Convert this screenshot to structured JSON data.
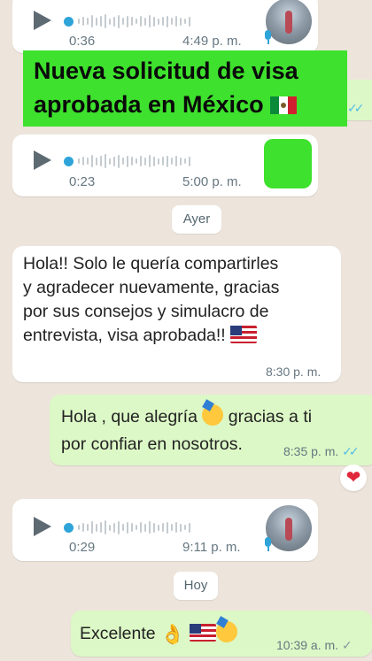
{
  "messages": {
    "voice1": {
      "duration": "0:36",
      "time": "4:49 p. m."
    },
    "voice2": {
      "duration": "0:23",
      "time": "5:00 p. m."
    },
    "day_yesterday": "Ayer",
    "msg_in_1": {
      "text": "Hola!! Solo le quería compartirles\ny agradecer nuevamente, gracias\npor sus consejos y simulacro de\nentrevista, visa aprobada!! ",
      "time": "8:30 p. m."
    },
    "msg_out_1": {
      "text_a": "Hola , que alegría ",
      "text_b": " gracias a ti",
      "text_c": "por confiar en nosotros.",
      "time": "8:35 p. m.",
      "reaction": "❤"
    },
    "voice3": {
      "duration": "0:29",
      "time": "9:11 p. m."
    },
    "day_today": "Hoy",
    "msg_out_2": {
      "text": "Excelente ",
      "time": "10:39 a. m."
    }
  },
  "banner": {
    "line1": "Nueva solicitud de visa",
    "line2": "aprobada en México "
  },
  "colors": {
    "banner": "#3ee12d",
    "outgoing": "#dcf8c6",
    "incoming": "#ffffff",
    "chat_bg": "#ede5dc",
    "read_ticks": "#53bdeb"
  },
  "icons": [
    "play-icon",
    "microphone-icon",
    "double-check-icon",
    "heart-reaction-icon",
    "flag-mexico-icon",
    "flag-usa-icon",
    "party-face-icon",
    "ok-hand-icon"
  ]
}
